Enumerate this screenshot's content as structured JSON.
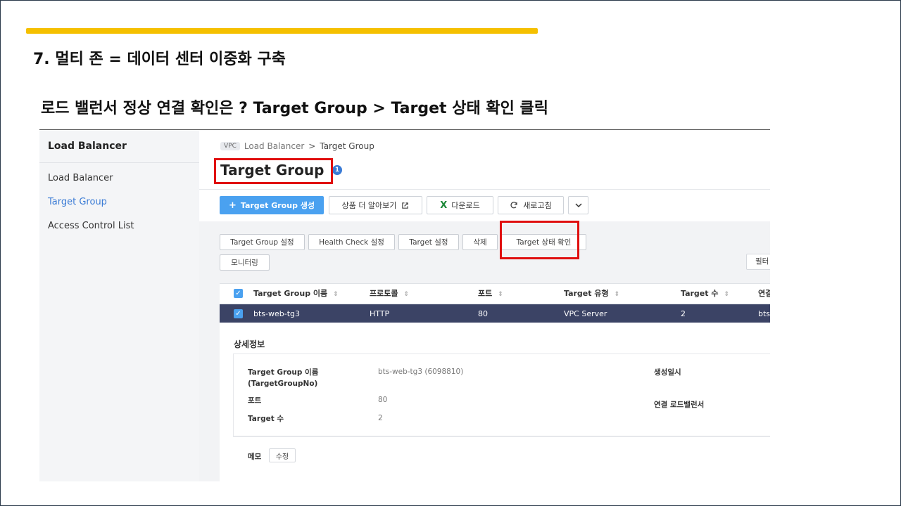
{
  "slide": {
    "title": "7. 멀티 존 = 데이터 센터 이중화 구축",
    "subtitle": "로드 밸런서 정상 연결 확인은 ?  Target Group > Target 상태 확인 클릭",
    "accent_color": "#f5c000",
    "highlight_color": "#e01010"
  },
  "sidebar": {
    "title": "Load Balancer",
    "items": [
      {
        "label": "Load Balancer"
      },
      {
        "label": "Target Group",
        "active": true
      },
      {
        "label": "Access Control List"
      }
    ]
  },
  "breadcrumb": {
    "badge": "VPC",
    "parent": "Load Balancer",
    "separator": ">",
    "current": "Target Group"
  },
  "page": {
    "title": "Target Group",
    "info_badge": "1"
  },
  "toolbar": {
    "create_icon": "+",
    "create_label": "Target Group 생성",
    "learn_label": "상품 더 알아보기",
    "learn_icon": "external-link-icon",
    "download_icon": "X",
    "download_label": "다운로드",
    "refresh_icon": "refresh-icon",
    "refresh_label": "새로고침",
    "more_icon": "chevron-down-icon"
  },
  "actions": {
    "tg_settings": "Target Group 설정",
    "health_check": "Health Check 설정",
    "target_settings": "Target 설정",
    "delete": "삭제",
    "target_status": "Target 상태 확인",
    "monitoring": "모니터링",
    "filter": "필터"
  },
  "table": {
    "columns": [
      "Target Group 이름",
      "프로토콜",
      "포트",
      "Target 유형",
      "Target 수",
      "연결"
    ],
    "rows": [
      {
        "name": "bts-web-tg3",
        "protocol": "HTTP",
        "port": "80",
        "target_type": "VPC Server",
        "target_count": "2",
        "lb": "bts"
      }
    ]
  },
  "detail": {
    "title": "상세정보",
    "name_label_1": "Target Group 이름",
    "name_label_2": "(TargetGroupNo)",
    "name_value": "bts-web-tg3 (6098810)",
    "port_label": "포트",
    "port_value": "80",
    "count_label": "Target 수",
    "count_value": "2",
    "created_label": "생성일시",
    "lb_label": "연결 로드밸런서",
    "memo_label": "메모",
    "memo_edit": "수정"
  }
}
